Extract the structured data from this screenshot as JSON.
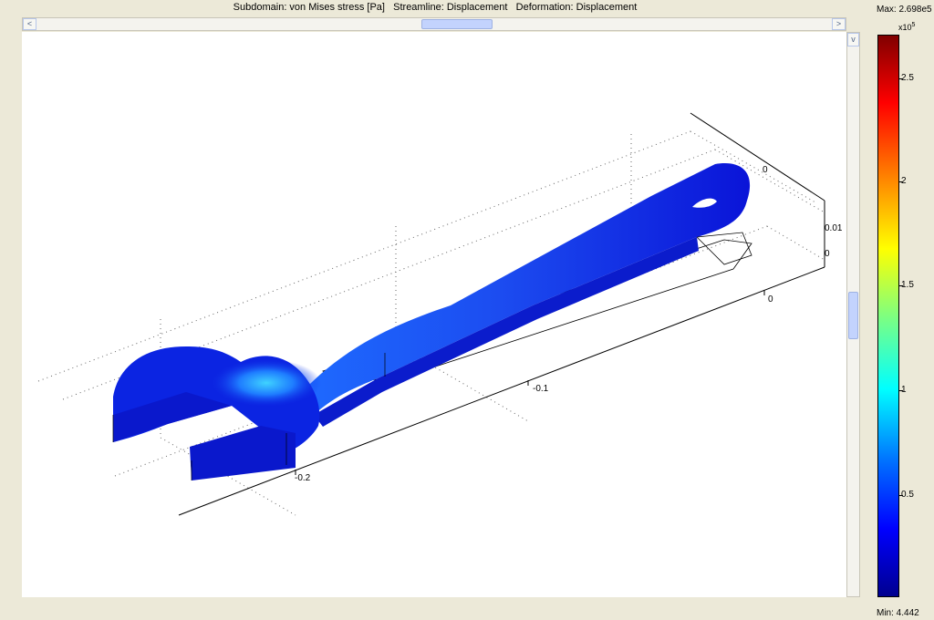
{
  "plot_title": "Subdomain: von Mises stress [Pa]   Streamline: Displacement   Deformation: Displacement",
  "hscroll": {
    "left_icon": "chevron-left-icon",
    "right_icon": "chevron-right-icon",
    "left_glyph": "<",
    "right_glyph": ">"
  },
  "vscroll": {
    "up_icon": "chevron-up-icon",
    "down_icon": "chevron-down-icon",
    "up_glyph": "^",
    "down_glyph": "v"
  },
  "axes": {
    "x_ticks": [
      "-0.2",
      "-0.1",
      "0"
    ],
    "y_ticks": [
      "0"
    ],
    "z_ticks": [
      "0.01",
      "0"
    ]
  },
  "colorbar": {
    "max_label": "Max: 2.698e5",
    "exponent_base": "x10",
    "exponent_power": "5",
    "ticks": [
      "2.5",
      "2",
      "1.5",
      "1",
      "0.5"
    ],
    "min_label": "Min: 4.442",
    "colormap": [
      "#00008f",
      "#0000ff",
      "#0070ff",
      "#00ffff",
      "#7fff7f",
      "#ffff00",
      "#ff8000",
      "#ff0000",
      "#800000"
    ]
  },
  "model": {
    "name": "wrench",
    "colors": {
      "body_dark": "#0a14d8",
      "body_mid": "#1e55ff",
      "highlight": "#2fb6ff"
    }
  }
}
